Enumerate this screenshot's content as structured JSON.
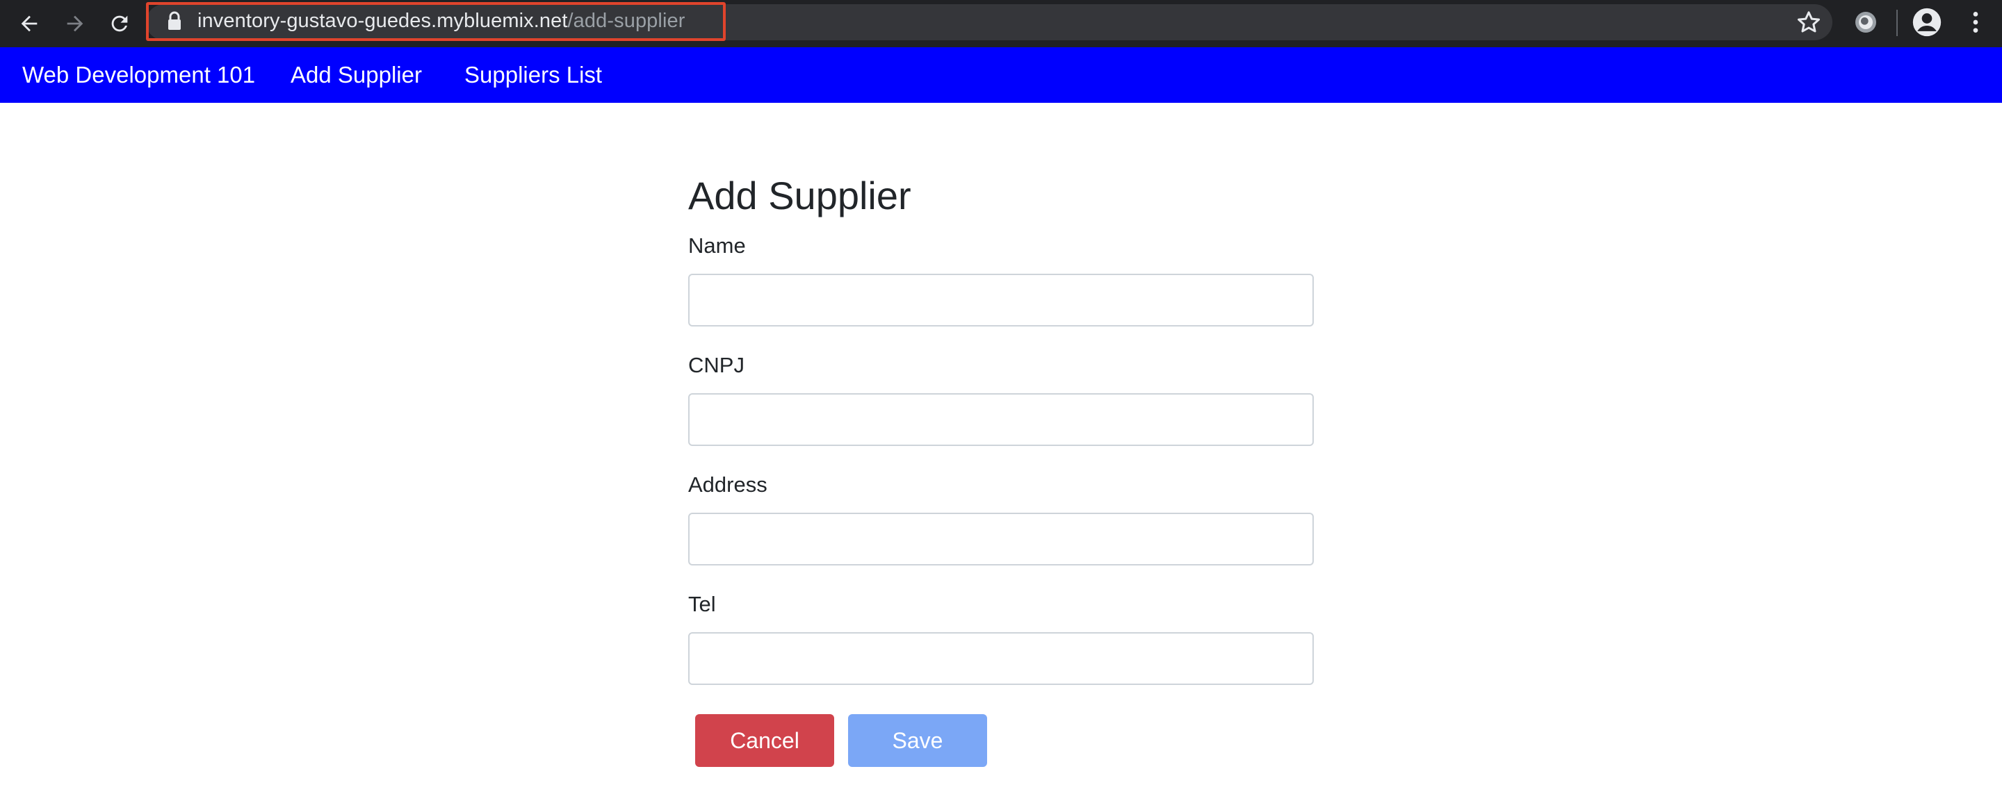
{
  "browser": {
    "url_host": "inventory-gustavo-guedes.mybluemix.net",
    "url_path": "/add-supplier",
    "icons": [
      "back-icon",
      "forward-icon",
      "reload-icon",
      "lock-icon",
      "star-icon",
      "extension-icon",
      "profile-icon",
      "menu-icon"
    ]
  },
  "navbar": {
    "brand": "Web Development 101",
    "links": [
      "Add Supplier",
      "Suppliers List"
    ],
    "background": "#0000ff"
  },
  "form": {
    "title": "Add Supplier",
    "fields": [
      {
        "label": "Name",
        "value": "",
        "placeholder": ""
      },
      {
        "label": "CNPJ",
        "value": "",
        "placeholder": ""
      },
      {
        "label": "Address",
        "value": "",
        "placeholder": ""
      },
      {
        "label": "Tel",
        "value": "",
        "placeholder": ""
      }
    ],
    "cancel_label": "Cancel",
    "save_label": "Save",
    "cancel_color": "#d1434c",
    "save_color": "#7ba7f6"
  }
}
